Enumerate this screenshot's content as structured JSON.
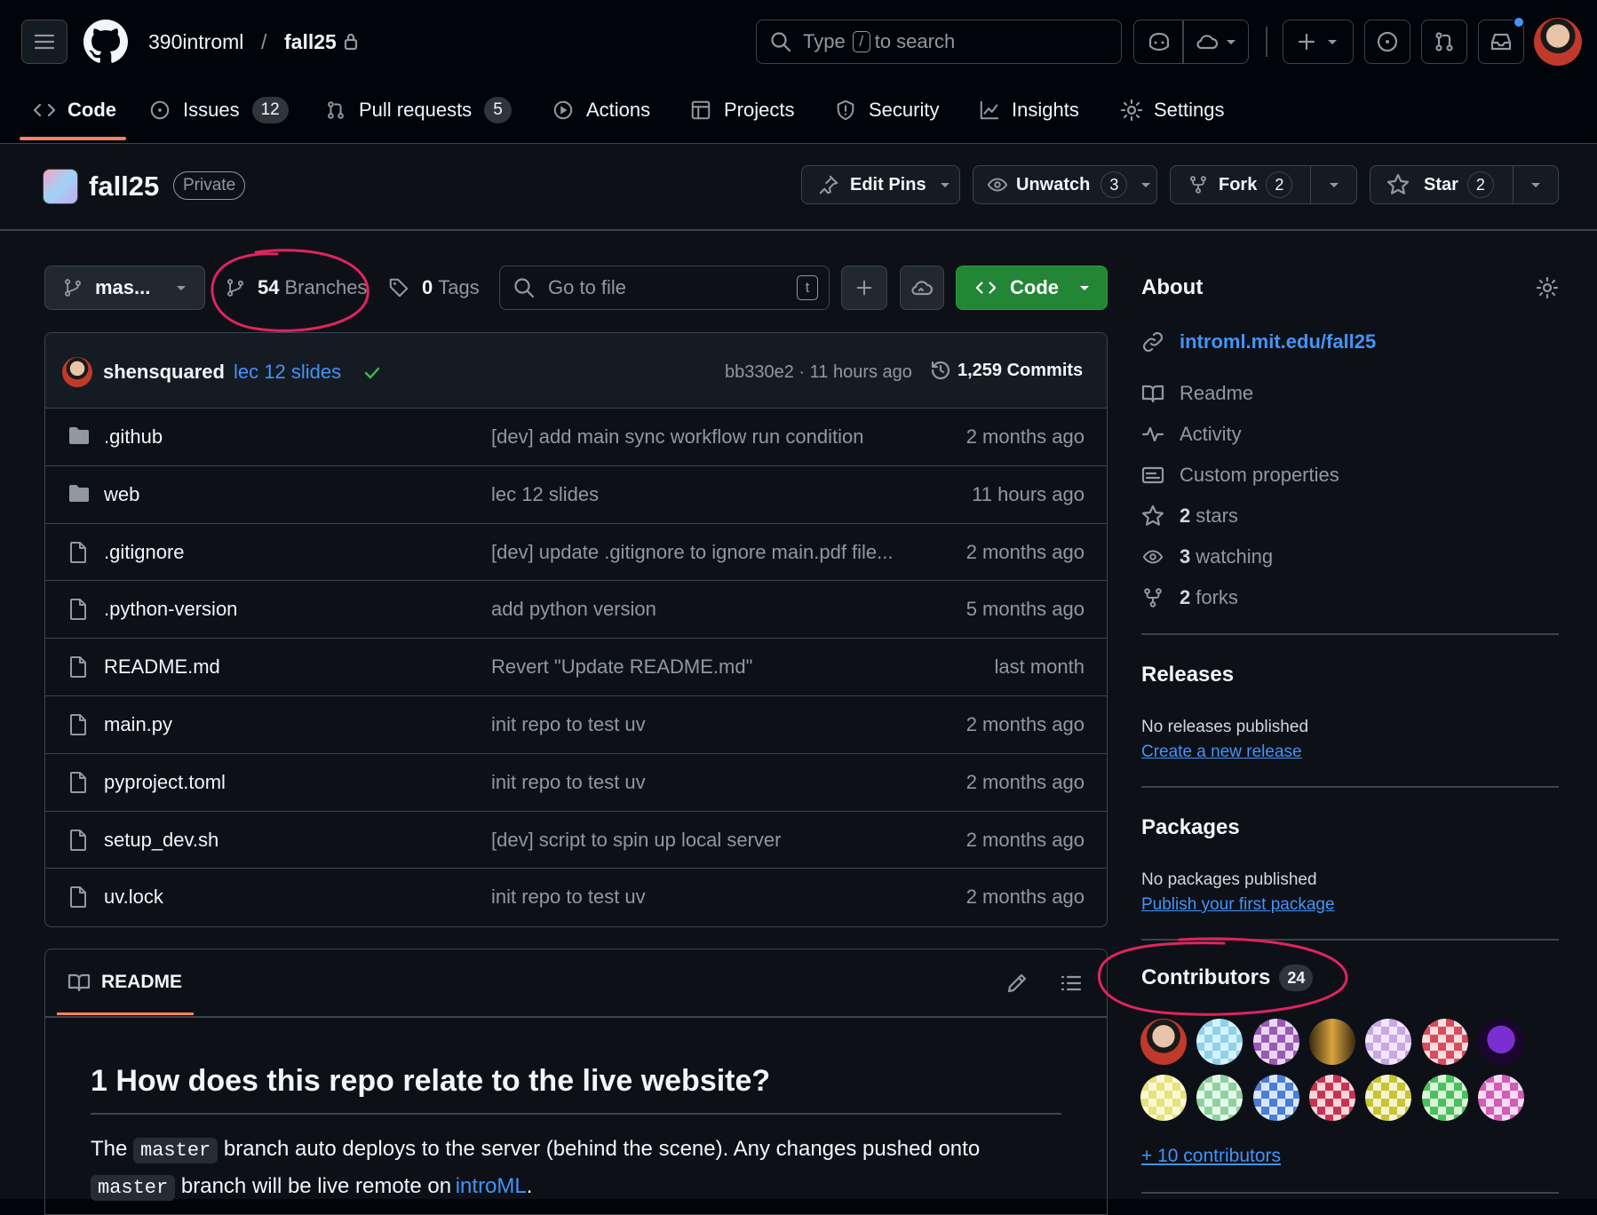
{
  "header": {
    "owner": "390introml",
    "separator": "/",
    "repo": "fall25",
    "search_prefix": "Type",
    "search_key": "/",
    "search_suffix": "to search"
  },
  "nav": {
    "code": "Code",
    "issues": "Issues",
    "issues_count": "12",
    "pulls": "Pull requests",
    "pulls_count": "5",
    "actions": "Actions",
    "projects": "Projects",
    "security": "Security",
    "insights": "Insights",
    "settings": "Settings"
  },
  "repo_head": {
    "name": "fall25",
    "visibility": "Private",
    "edit_pins": "Edit Pins",
    "unwatch": "Unwatch",
    "unwatch_count": "3",
    "fork": "Fork",
    "fork_count": "2",
    "star": "Star",
    "star_count": "2"
  },
  "toolbar": {
    "branch": "mas...",
    "branches_count": "54",
    "branches_label": "Branches",
    "tags_count": "0",
    "tags_label": "Tags",
    "goto_placeholder": "Go to file",
    "goto_key": "t",
    "code_button": "Code"
  },
  "commit": {
    "author": "shensquared",
    "message": "lec 12 slides",
    "hash_time": "bb330e2 · 11 hours ago",
    "commits": "1,259 Commits"
  },
  "files": [
    {
      "name": ".github",
      "type": "folder",
      "message": "[dev] add main sync workflow run condition",
      "time": "2 months ago"
    },
    {
      "name": "web",
      "type": "folder",
      "message": "lec 12 slides",
      "time": "11 hours ago"
    },
    {
      "name": ".gitignore",
      "type": "file",
      "message": "[dev] update .gitignore to ignore main.pdf file...",
      "time": "2 months ago"
    },
    {
      "name": ".python-version",
      "type": "file",
      "message": "add python version",
      "time": "5 months ago"
    },
    {
      "name": "README.md",
      "type": "file",
      "message": "Revert \"Update README.md\"",
      "time": "last month"
    },
    {
      "name": "main.py",
      "type": "file",
      "message": "init repo to test uv",
      "time": "2 months ago"
    },
    {
      "name": "pyproject.toml",
      "type": "file",
      "message": "init repo to test uv",
      "time": "2 months ago"
    },
    {
      "name": "setup_dev.sh",
      "type": "file",
      "message": "[dev] script to spin up local server",
      "time": "2 months ago"
    },
    {
      "name": "uv.lock",
      "type": "file",
      "message": "init repo to test uv",
      "time": "2 months ago"
    }
  ],
  "readme": {
    "tab": "README",
    "heading": "1 How does this repo relate to the live website?",
    "p1_a": "The",
    "p1_code1": "master",
    "p1_b": "branch auto deploys to the server (behind the scene). Any changes pushed onto",
    "p1_code2": "master",
    "p1_c": "branch will be live remote on",
    "p1_link": "introML",
    "p1_d": "."
  },
  "about": {
    "title": "About",
    "url": "introml.mit.edu/fall25",
    "readme": "Readme",
    "activity": "Activity",
    "custom_properties": "Custom properties",
    "stars_num": "2",
    "stars_label": "stars",
    "watching_num": "3",
    "watching_label": "watching",
    "forks_num": "2",
    "forks_label": "forks"
  },
  "releases": {
    "title": "Releases",
    "empty": "No releases published",
    "link": "Create a new release"
  },
  "packages": {
    "title": "Packages",
    "empty": "No packages published",
    "link": "Publish your first package"
  },
  "contributors": {
    "title": "Contributors",
    "count": "24",
    "more": "+ 10 contributors"
  },
  "colors": {
    "accent_blue": "#4493f8",
    "green_button": "#238636",
    "annotation_red": "#e0245e"
  }
}
